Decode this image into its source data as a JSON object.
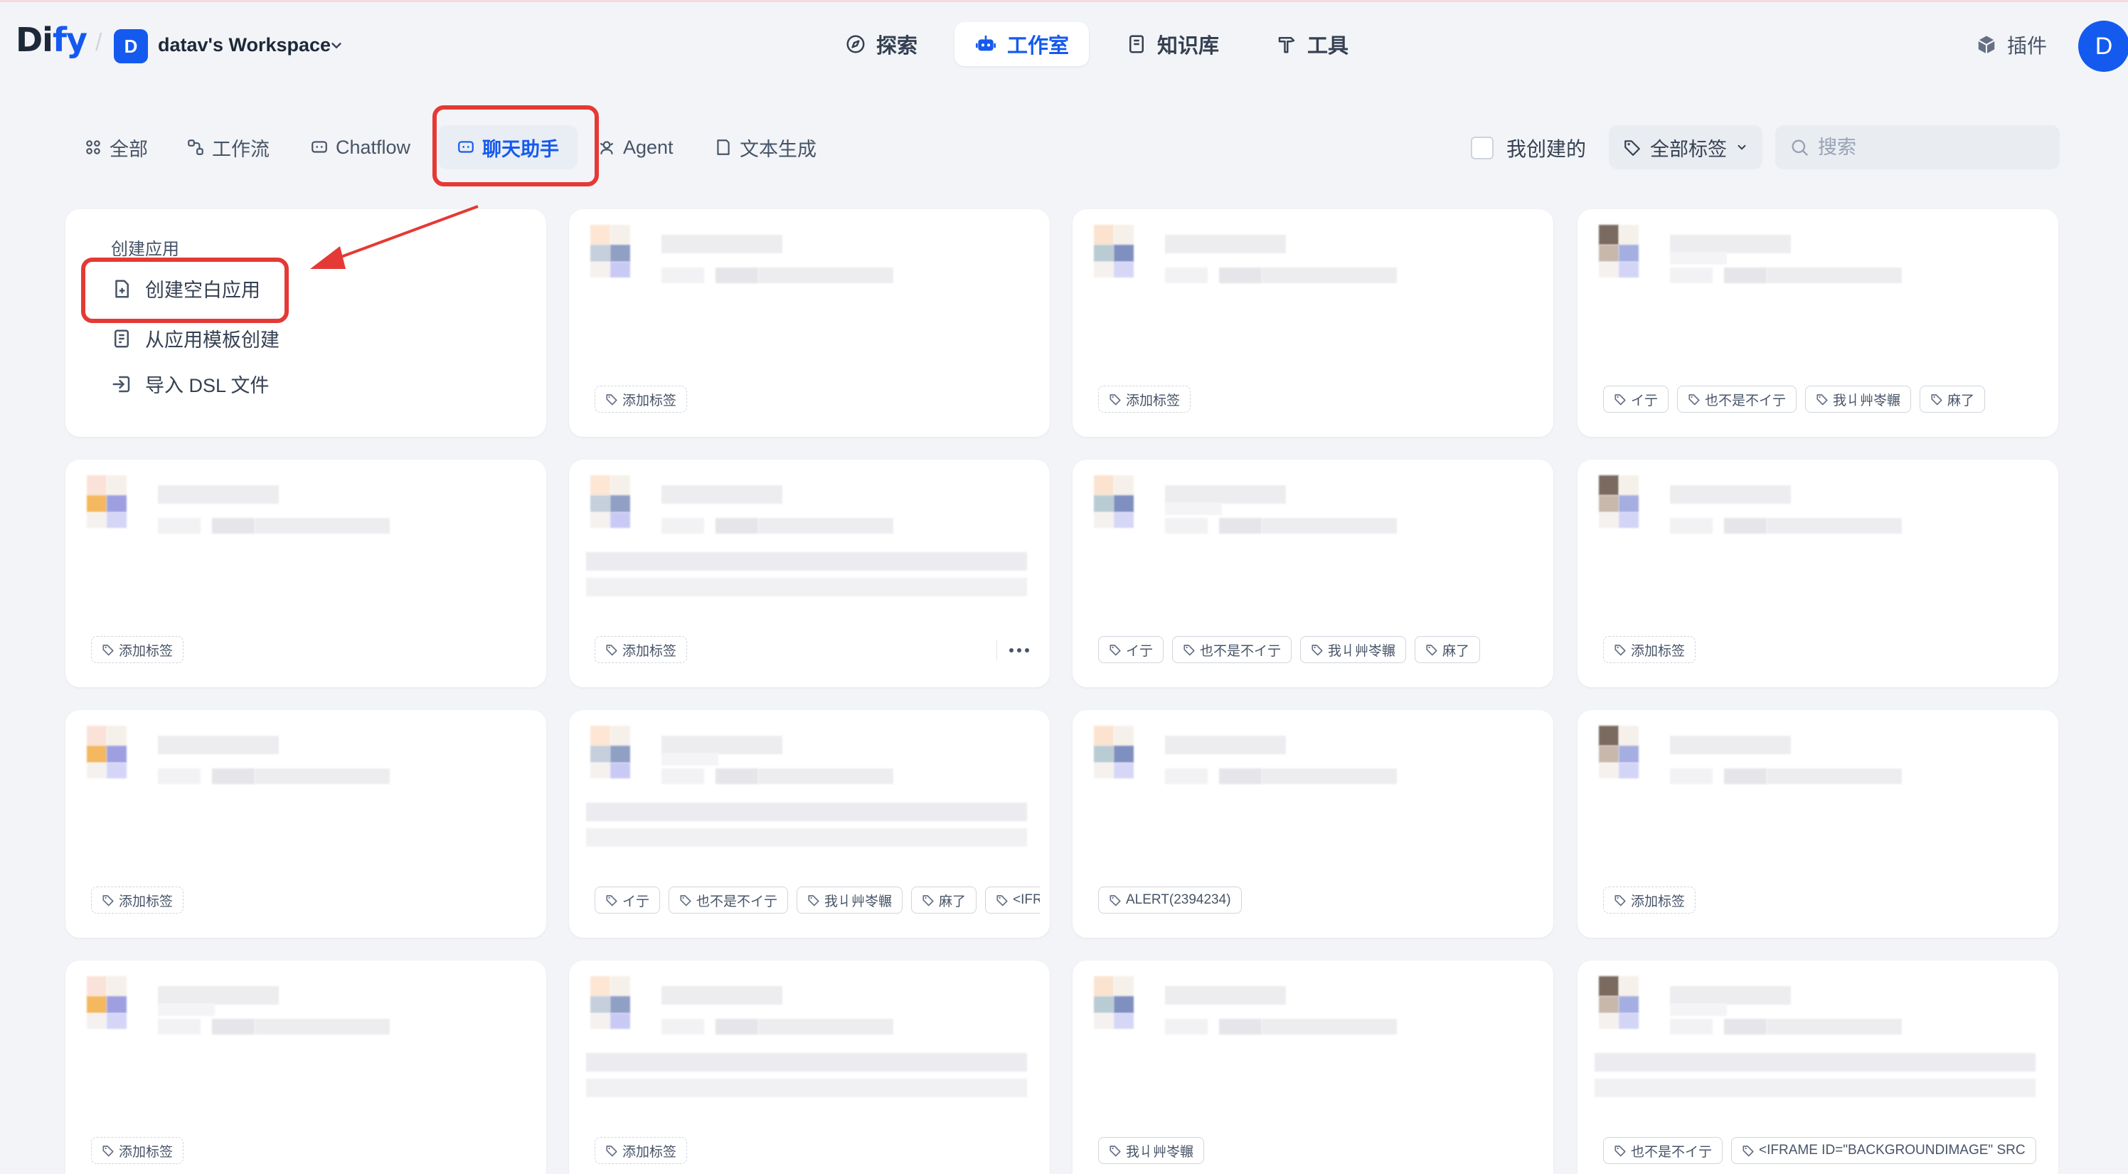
{
  "header": {
    "logo": {
      "main": "Di",
      "accent": "fy",
      "rest": ""
    },
    "workspace": {
      "initial": "D",
      "name": "datav's Workspace"
    },
    "nav": [
      {
        "label": "探索",
        "icon": "compass-icon"
      },
      {
        "label": "工作室",
        "icon": "robot-icon",
        "active": true
      },
      {
        "label": "知识库",
        "icon": "book-icon"
      },
      {
        "label": "工具",
        "icon": "hammer-icon"
      }
    ],
    "plugins_label": "插件",
    "user_initial": "D"
  },
  "filters": {
    "tabs": [
      {
        "label": "全部",
        "icon": "grid-icon"
      },
      {
        "label": "工作流",
        "icon": "workflow-icon"
      },
      {
        "label": "Chatflow",
        "icon": "chatflow-icon"
      },
      {
        "label": "聊天助手",
        "icon": "chat-icon",
        "active": true
      },
      {
        "label": "Agent",
        "icon": "agent-icon"
      },
      {
        "label": "文本生成",
        "icon": "text-icon"
      }
    ],
    "created_by_me": "我创建的",
    "all_tags": "全部标签",
    "search_placeholder": "搜索"
  },
  "create": {
    "title": "创建应用",
    "items": [
      {
        "label": "创建空白应用",
        "icon": "file-plus-icon"
      },
      {
        "label": "从应用模板创建",
        "icon": "template-icon"
      },
      {
        "label": "导入 DSL 文件",
        "icon": "import-icon"
      }
    ]
  },
  "cards": [
    {
      "tags": [
        "添加标签"
      ]
    },
    {
      "tags": [
        "添加标签"
      ]
    },
    {
      "tags": [
        "イ亍",
        "也不是不イ亍",
        "我丩艸岺冁",
        "麻了"
      ]
    },
    {
      "tags": [
        "添加标签"
      ]
    },
    {
      "tags": [
        "添加标签"
      ],
      "has_more": true
    },
    {
      "tags": [
        "イ亍",
        "也不是不イ亍",
        "我丩艸岺冁",
        "麻了"
      ]
    },
    {
      "tags": [
        "添加标签"
      ]
    },
    {
      "tags": [
        "添加标签"
      ]
    },
    {
      "tags": [
        "イ亍",
        "也不是不イ亍",
        "我丩艸岺冁",
        "麻了",
        "<IFR"
      ]
    },
    {
      "tags": [
        "ALERT(2394234)"
      ]
    },
    {
      "tags": [
        "添加标签"
      ]
    },
    {
      "tags": [
        "添加标签"
      ]
    },
    {
      "tags": [
        "添加标签"
      ]
    },
    {
      "tags": [
        "我丩艸岺冁"
      ]
    },
    {
      "tags": [
        "也不是不イ亍",
        "<IFRAME ID=\"BACKGROUNDIMAGE\" SRC"
      ]
    }
  ],
  "colors": {
    "accent": "#155aef",
    "annotation": "#e53935",
    "background": "#f2f4f7"
  }
}
